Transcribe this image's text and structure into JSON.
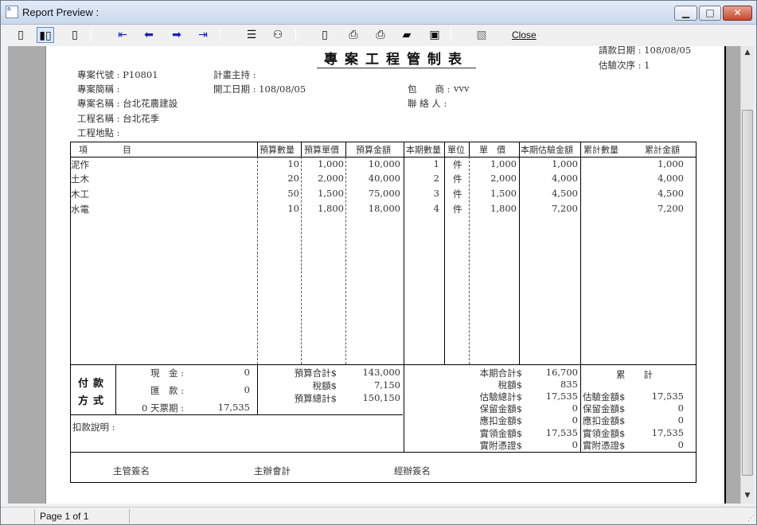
{
  "window": {
    "title": "Report Preview :",
    "icon_label": "R"
  },
  "toolbar": {
    "buttons": [
      {
        "name": "single-page-icon"
      },
      {
        "name": "two-page-icon"
      },
      {
        "name": "book-page-icon"
      },
      {
        "name": "first-page-icon"
      },
      {
        "name": "previous-page-icon"
      },
      {
        "name": "next-page-icon"
      },
      {
        "name": "last-page-icon"
      },
      {
        "name": "goto-page-icon"
      },
      {
        "name": "find-binoculars-icon"
      },
      {
        "name": "new-document-icon"
      },
      {
        "name": "printer-setup-icon"
      },
      {
        "name": "print-icon"
      },
      {
        "name": "open-folder-icon"
      },
      {
        "name": "save-disk-icon"
      },
      {
        "name": "export-icon"
      }
    ],
    "close_label": "Close"
  },
  "status": {
    "page": "Page 1 of 1"
  },
  "report": {
    "title": "專案工程管制表",
    "top_right": {
      "request_date": "請款日期 : 108/08/05",
      "sequence": "估驗次序 : 1"
    },
    "header": {
      "project_code": "專案代號 : P10801",
      "project_abbrev": "專案簡稱 :",
      "project_name": "專案名稱 : 台北花農建設",
      "work_name": "工程名稱 : 台北花季",
      "work_site": "工程地點 :",
      "plan_host": "計畫主持 :",
      "start_date": "開工日期 : 108/08/05",
      "contractor_label": "包　　商 :",
      "contractor_value": "vvv",
      "contact": "聯 絡 人 :"
    },
    "columns": [
      "項　　　　目",
      "預算數量",
      "預算單價",
      "預算金額",
      "本期數量",
      "單位",
      "單　價",
      "本期估驗金額",
      "累計數量",
      "累計金額"
    ],
    "rows": [
      {
        "item": "泥作",
        "bq": "10",
        "bp": "1,000",
        "ba": "10,000",
        "cq": "1",
        "unit": "件",
        "up": "1,000",
        "ca": "1,000",
        "tq": "",
        "ta": "1,000"
      },
      {
        "item": "土木",
        "bq": "20",
        "bp": "2,000",
        "ba": "40,000",
        "cq": "2",
        "unit": "件",
        "up": "2,000",
        "ca": "4,000",
        "tq": "",
        "ta": "4,000"
      },
      {
        "item": "木工",
        "bq": "50",
        "bp": "1,500",
        "ba": "75,000",
        "cq": "3",
        "unit": "件",
        "up": "1,500",
        "ca": "4,500",
        "tq": "",
        "ta": "4,500"
      },
      {
        "item": "水電",
        "bq": "10",
        "bp": "1,800",
        "ba": "18,000",
        "cq": "4",
        "unit": "件",
        "up": "1,800",
        "ca": "7,200",
        "tq": "",
        "ta": "7,200"
      }
    ],
    "payment": {
      "heading_1": "付款",
      "heading_2": "方式",
      "cash_label": "現　金 :",
      "cash_value": "0",
      "remit_label": "匯　款 :",
      "remit_value": "0",
      "note_label": "0 天票期 :",
      "note_value": "17,535"
    },
    "budget": {
      "subtotal_label": "預算合計$",
      "subtotal_value": "143,000",
      "tax_label": "稅額$",
      "tax_value": "7,150",
      "total_label": "預算總計$",
      "total_value": "150,150"
    },
    "current": {
      "subtotal_label": "本期合計$",
      "subtotal_value": "16,700",
      "tax_label": "稅額$",
      "tax_value": "835",
      "est_total_label": "估驗總計$",
      "est_total_value": "17,535",
      "retention_label": "保留金額$",
      "retention_value": "0",
      "deduct_label": "應扣金額$",
      "deduct_value": "0",
      "actual_label": "實領金額$",
      "actual_value": "17,535",
      "voucher_label": "實附憑證$",
      "voucher_value": "0"
    },
    "cumulative": {
      "heading": "累　　計",
      "est_label": "估驗金額$",
      "est_value": "17,535",
      "retention_label": "保留金額$",
      "retention_value": "0",
      "deduct_label": "應扣金額$",
      "deduct_value": "0",
      "actual_label": "實領金額$",
      "actual_value": "17,535",
      "voucher_label": "實附憑證$",
      "voucher_value": "0"
    },
    "deduction_note": "扣款說明 :",
    "signatures": {
      "supervisor": "主管簽名",
      "accounting": "主辦會計",
      "handler": "經辦簽名"
    }
  }
}
